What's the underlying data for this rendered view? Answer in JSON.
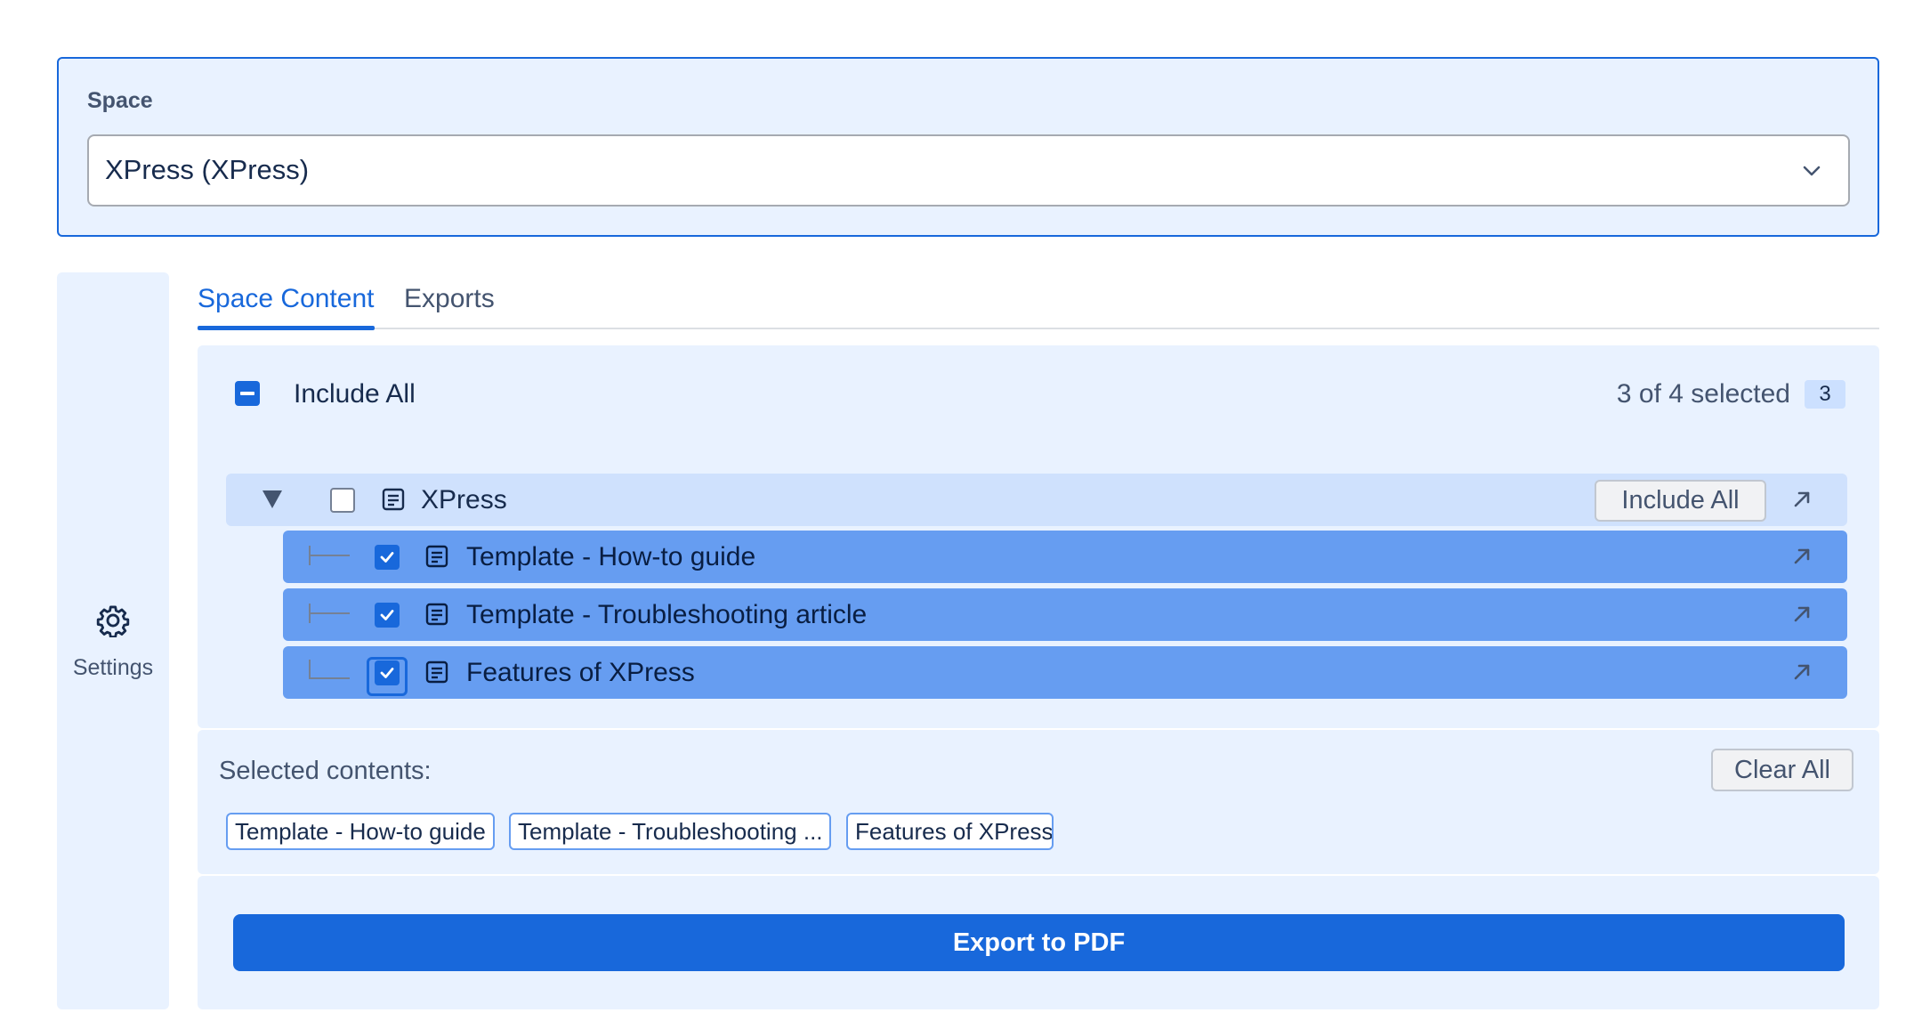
{
  "space": {
    "label": "Space",
    "selected": "XPress (XPress)",
    "dropdown_icon": "chevron-down-icon"
  },
  "sidebar": {
    "icon": "gear-icon",
    "label": "Settings"
  },
  "tabs": [
    {
      "label": "Space Content",
      "active": true
    },
    {
      "label": "Exports",
      "active": false
    }
  ],
  "content": {
    "include_all_label": "Include All",
    "include_all_state": "indeterminate",
    "selected_count_text": "3 of 4 selected",
    "selected_count_badge": "3",
    "tree": {
      "root": {
        "label": "XPress",
        "checked": false,
        "expanded": true,
        "include_all_button": "Include All",
        "icon": "page-icon",
        "open_icon": "arrow-up-right-icon"
      },
      "children": [
        {
          "label": "Template - How-to guide",
          "checked": true
        },
        {
          "label": "Template - Troubleshooting article",
          "checked": true
        },
        {
          "label": "Features of XPress",
          "checked": true,
          "focused": true
        }
      ]
    }
  },
  "selected_contents": {
    "title": "Selected contents:",
    "clear_button": "Clear All",
    "chips": [
      "Template - How-to guide",
      "Template - Troubleshooting ...",
      "Features of XPress"
    ]
  },
  "export": {
    "button_label": "Export to PDF"
  },
  "colors": {
    "accent": "#1868db",
    "panel_bg": "#e9f2ff",
    "selected_row": "#669df1",
    "root_row": "#cfe1fd"
  }
}
